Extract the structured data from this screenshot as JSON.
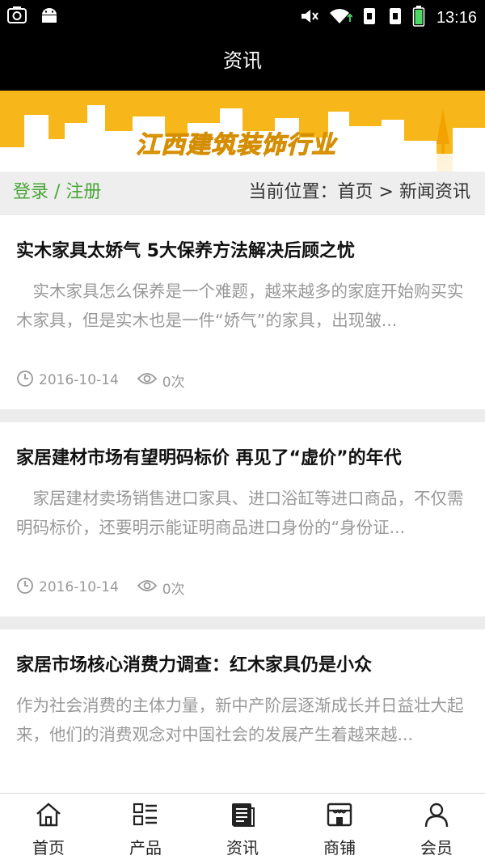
{
  "status_bar": {
    "time": "13:16",
    "left_icons": [
      "screenshot-icon",
      "android-icon"
    ],
    "right_icons": [
      "mute-icon",
      "wifi-icon",
      "sim1-icon",
      "sim2-icon",
      "battery-icon"
    ]
  },
  "header": {
    "title": "资讯"
  },
  "banner": {
    "text": "江西建筑装饰行业",
    "color": "#f7b619"
  },
  "auth": {
    "login": "登录",
    "separator": " / ",
    "register": "注册"
  },
  "breadcrumb": {
    "label": "当前位置：",
    "home": "首页",
    "sep": " > ",
    "current": "新闻资讯"
  },
  "articles": [
    {
      "title": "实木家具太娇气 5大保养方法解决后顾之忧",
      "summary": "　实木家具怎么保养是一个难题，越来越多的家庭开始购买实木家具，但是实木也是一件“娇气”的家具，出现皱...",
      "date": "2016-10-14",
      "views": "0次"
    },
    {
      "title": "家居建材市场有望明码标价 再见了“虚价”的年代",
      "summary": "　家居建材卖场销售进口家具、进口浴缸等进口商品，不仅需明码标价，还要明示能证明商品进口身份的“身份证...",
      "date": "2016-10-14",
      "views": "0次"
    },
    {
      "title": "家居市场核心消费力调查：红木家具仍是小众",
      "summary": "作为社会消费的主体力量，新中产阶层逐渐成长并日益壮大起来，他们的消费观念对中国社会的发展产生着越来越...",
      "date": "",
      "views": ""
    }
  ],
  "bottom_nav": [
    {
      "label": "首页",
      "icon": "home-icon"
    },
    {
      "label": "产品",
      "icon": "product-list-icon"
    },
    {
      "label": "资讯",
      "icon": "news-icon"
    },
    {
      "label": "商铺",
      "icon": "shop-icon"
    },
    {
      "label": "会员",
      "icon": "member-icon"
    }
  ]
}
